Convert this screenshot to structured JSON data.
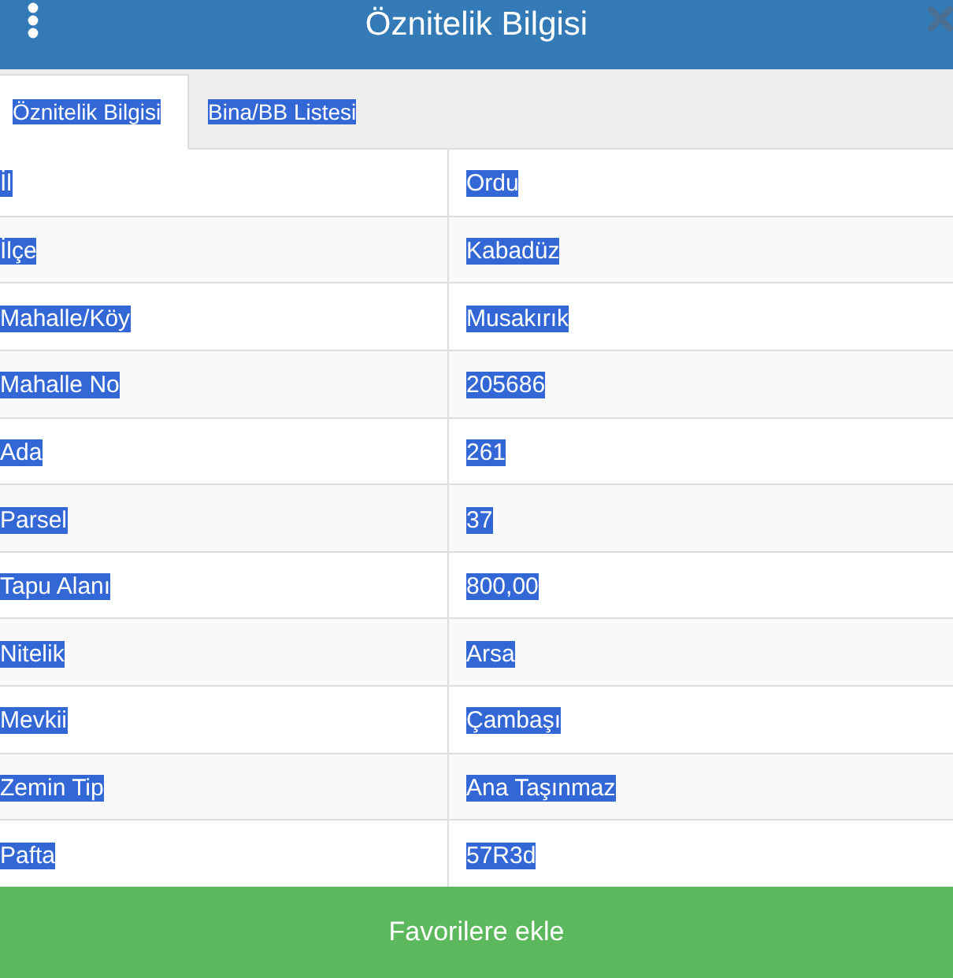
{
  "window": {
    "title": "Öznitelik Bilgisi"
  },
  "tabs": [
    {
      "label": "Öznitelik Bilgisi",
      "selected": true
    },
    {
      "label": "Bina/BB Listesi",
      "selected": false
    }
  ],
  "table": {
    "rows": [
      {
        "label": "İl",
        "value": "Ordu"
      },
      {
        "label": "İlçe",
        "value": "Kabadüz"
      },
      {
        "label": "Mahalle/Köy",
        "value": "Musakırık"
      },
      {
        "label": "Mahalle No",
        "value": "205686"
      },
      {
        "label": "Ada",
        "value": "261"
      },
      {
        "label": "Parsel",
        "value": "37"
      },
      {
        "label": "Tapu Alanı",
        "value": "800,00"
      },
      {
        "label": "Nitelik",
        "value": "Arsa"
      },
      {
        "label": "Mevkii",
        "value": "Çambaşı"
      },
      {
        "label": "Zemin Tip",
        "value": "Ana Taşınmaz"
      },
      {
        "label": "Pafta",
        "value": "57R3d"
      }
    ]
  },
  "button": {
    "label": "Favorilere ekle"
  }
}
